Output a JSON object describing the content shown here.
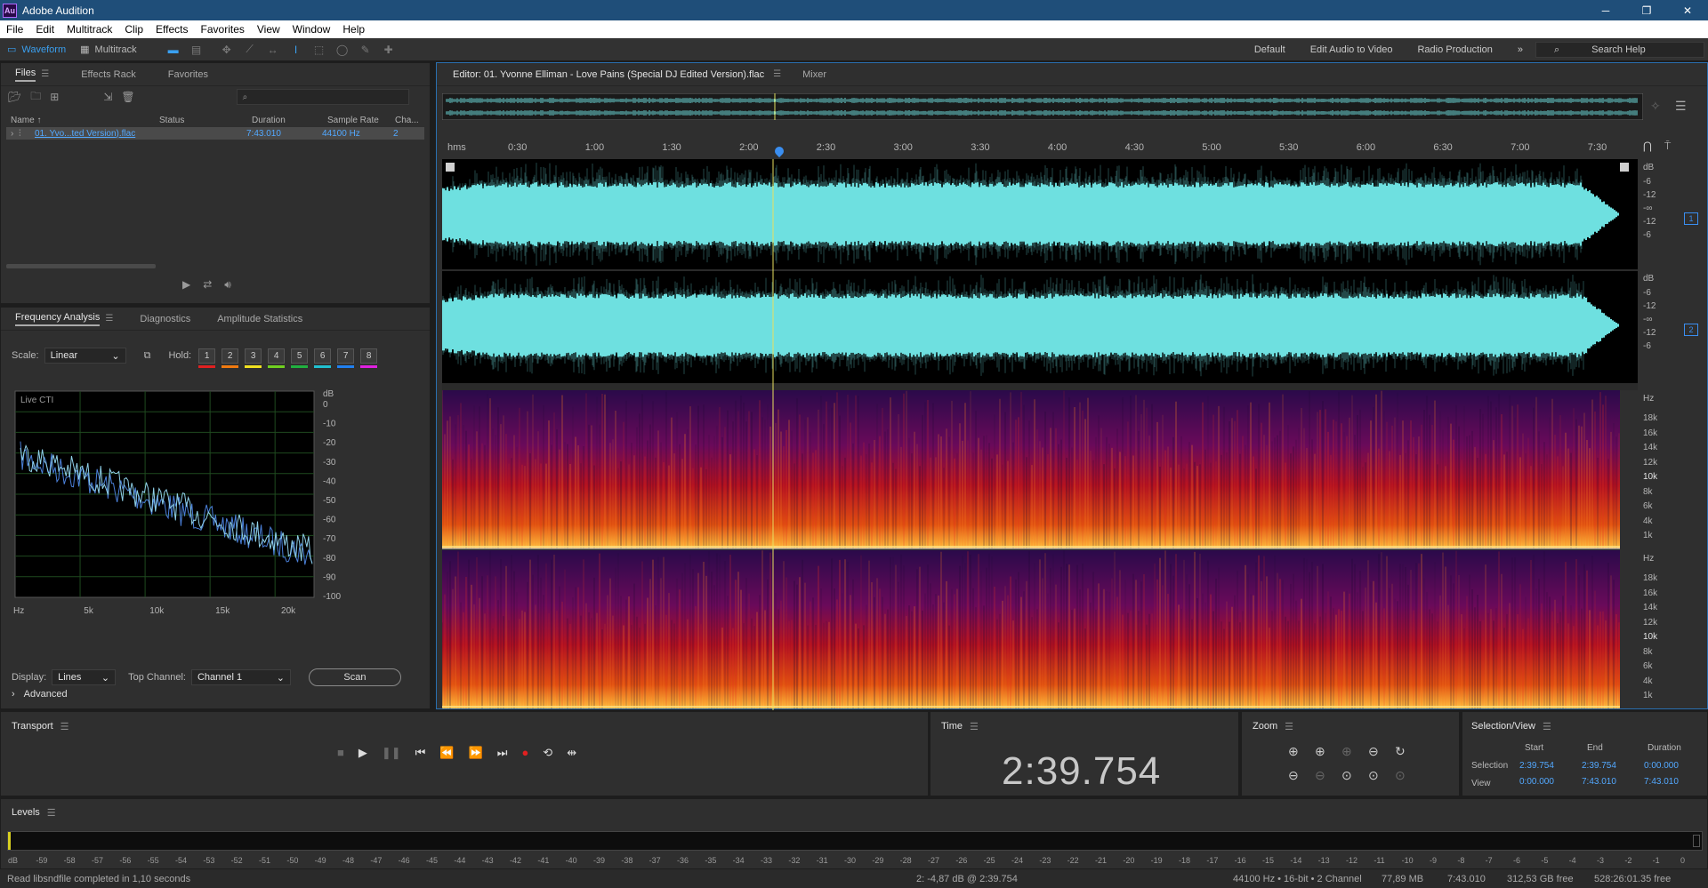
{
  "app": {
    "title": "Adobe Audition",
    "logo_text": "Au"
  },
  "window_controls": {
    "minimize": "─",
    "restore": "❐",
    "close": "✕"
  },
  "menu": [
    "File",
    "Edit",
    "Multitrack",
    "Clip",
    "Effects",
    "Favorites",
    "View",
    "Window",
    "Help"
  ],
  "toolbar": {
    "waveform_label": "Waveform",
    "multitrack_label": "Multitrack",
    "workspaces": [
      "Default",
      "Edit Audio to Video",
      "Radio Production"
    ],
    "more": "»",
    "search_placeholder": "Search Help"
  },
  "files_panel": {
    "tabs": [
      "Files",
      "Effects Rack",
      "Favorites"
    ],
    "columns": [
      "Name ↑",
      "Status",
      "Duration",
      "Sample Rate",
      "Cha..."
    ],
    "rows": [
      {
        "name": "01. Yvo...ted Version).flac",
        "status": "",
        "duration": "7:43.010",
        "sample_rate": "44100 Hz",
        "channels": "2"
      }
    ]
  },
  "freq_panel": {
    "tabs": [
      "Frequency Analysis",
      "Diagnostics",
      "Amplitude Statistics"
    ],
    "scale_label": "Scale:",
    "scale_value": "Linear",
    "hold_label": "Hold:",
    "hold_buttons": [
      "1",
      "2",
      "3",
      "4",
      "5",
      "6",
      "7",
      "8"
    ],
    "hold_colors": [
      "#e02020",
      "#f07a10",
      "#f0e020",
      "#70d020",
      "#20b040",
      "#20c0d0",
      "#2080f0",
      "#e020e0"
    ],
    "graph_label": "Live CTI",
    "db_unit": "dB",
    "db_ticks": [
      "0",
      "-10",
      "-20",
      "-30",
      "-40",
      "-50",
      "-60",
      "-70",
      "-80",
      "-90",
      "-100"
    ],
    "x_ticks": [
      "Hz",
      "5k",
      "10k",
      "15k",
      "20k"
    ],
    "display_label": "Display:",
    "display_value": "Lines",
    "top_channel_label": "Top Channel:",
    "top_channel_value": "Channel 1",
    "scan_label": "Scan",
    "advanced_label": "Advanced"
  },
  "editor": {
    "tab_title": "Editor: 01. Yvonne Elliman - Love Pains (Special DJ Edited Version).flac",
    "mixer_tab": "Mixer",
    "ruler_labels": [
      "hms",
      "0:30",
      "1:00",
      "1:30",
      "2:00",
      "2:30",
      "3:00",
      "3:30",
      "4:00",
      "4:30",
      "5:00",
      "5:30",
      "6:00",
      "6:30",
      "7:00",
      "7:30"
    ],
    "db_label": "dB",
    "db_scale": [
      "-6",
      "-12",
      "-∞",
      "-12",
      "-6"
    ],
    "channel_badges": [
      "1",
      "2"
    ],
    "hz_label": "Hz",
    "hz_scale": [
      "18k",
      "16k",
      "14k",
      "12k",
      "10k",
      "8k",
      "6k",
      "4k",
      "1k"
    ],
    "playhead_time": "2:39.754",
    "waveform_color": "#6ee0e0"
  },
  "transport": {
    "title": "Transport"
  },
  "time_panel": {
    "title": "Time",
    "value": "2:39.754"
  },
  "zoom_panel": {
    "title": "Zoom"
  },
  "selection_view": {
    "title": "Selection/View",
    "headers": [
      "Start",
      "End",
      "Duration"
    ],
    "rows": [
      {
        "label": "Selection",
        "start": "2:39.754",
        "end": "2:39.754",
        "duration": "0:00.000"
      },
      {
        "label": "View",
        "start": "0:00.000",
        "end": "7:43.010",
        "duration": "7:43.010"
      }
    ]
  },
  "levels": {
    "title": "Levels",
    "scale": [
      "dB",
      "-59",
      "-58",
      "-57",
      "-56",
      "-55",
      "-54",
      "-53",
      "-52",
      "-51",
      "-50",
      "-49",
      "-48",
      "-47",
      "-46",
      "-45",
      "-44",
      "-43",
      "-42",
      "-41",
      "-40",
      "-39",
      "-38",
      "-37",
      "-36",
      "-35",
      "-34",
      "-33",
      "-32",
      "-31",
      "-30",
      "-29",
      "-28",
      "-27",
      "-26",
      "-25",
      "-24",
      "-23",
      "-22",
      "-21",
      "-20",
      "-19",
      "-18",
      "-17",
      "-16",
      "-15",
      "-14",
      "-13",
      "-12",
      "-11",
      "-10",
      "-9",
      "-8",
      "-7",
      "-6",
      "-5",
      "-4",
      "-3",
      "-2",
      "-1",
      "0"
    ]
  },
  "status": {
    "message": "Read libsndfile completed in 1,10 seconds",
    "cursor_info": "2: -4,87 dB @ 2:39.754",
    "format": "44100 Hz • 16-bit • 2 Channel",
    "size": "77,89 MB",
    "duration": "7:43.010",
    "free": "312,53 GB free",
    "free_time": "528:26:01.35 free"
  }
}
